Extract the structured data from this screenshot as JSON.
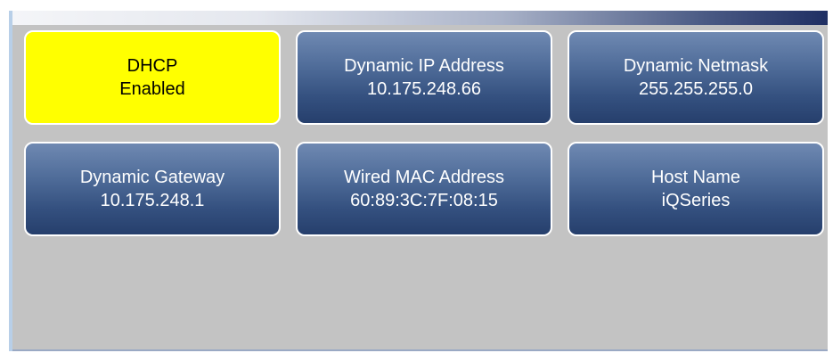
{
  "colors": {
    "panel_background": "#c3c3c3",
    "tile_blue": "#3b5685",
    "tile_active": "#ffff00",
    "title_bar_dark": "#1f2f63"
  },
  "tiles": [
    {
      "title": "DHCP",
      "value": "Enabled",
      "state": "active"
    },
    {
      "title": "Dynamic IP Address",
      "value": "10.175.248.66",
      "state": "normal"
    },
    {
      "title": "Dynamic Netmask",
      "value": "255.255.255.0",
      "state": "normal"
    },
    {
      "title": "Dynamic Gateway",
      "value": "10.175.248.1",
      "state": "normal"
    },
    {
      "title": "Wired MAC Address",
      "value": "60:89:3C:7F:08:15",
      "state": "normal"
    },
    {
      "title": "Host Name",
      "value": "iQSeries",
      "state": "normal"
    }
  ]
}
